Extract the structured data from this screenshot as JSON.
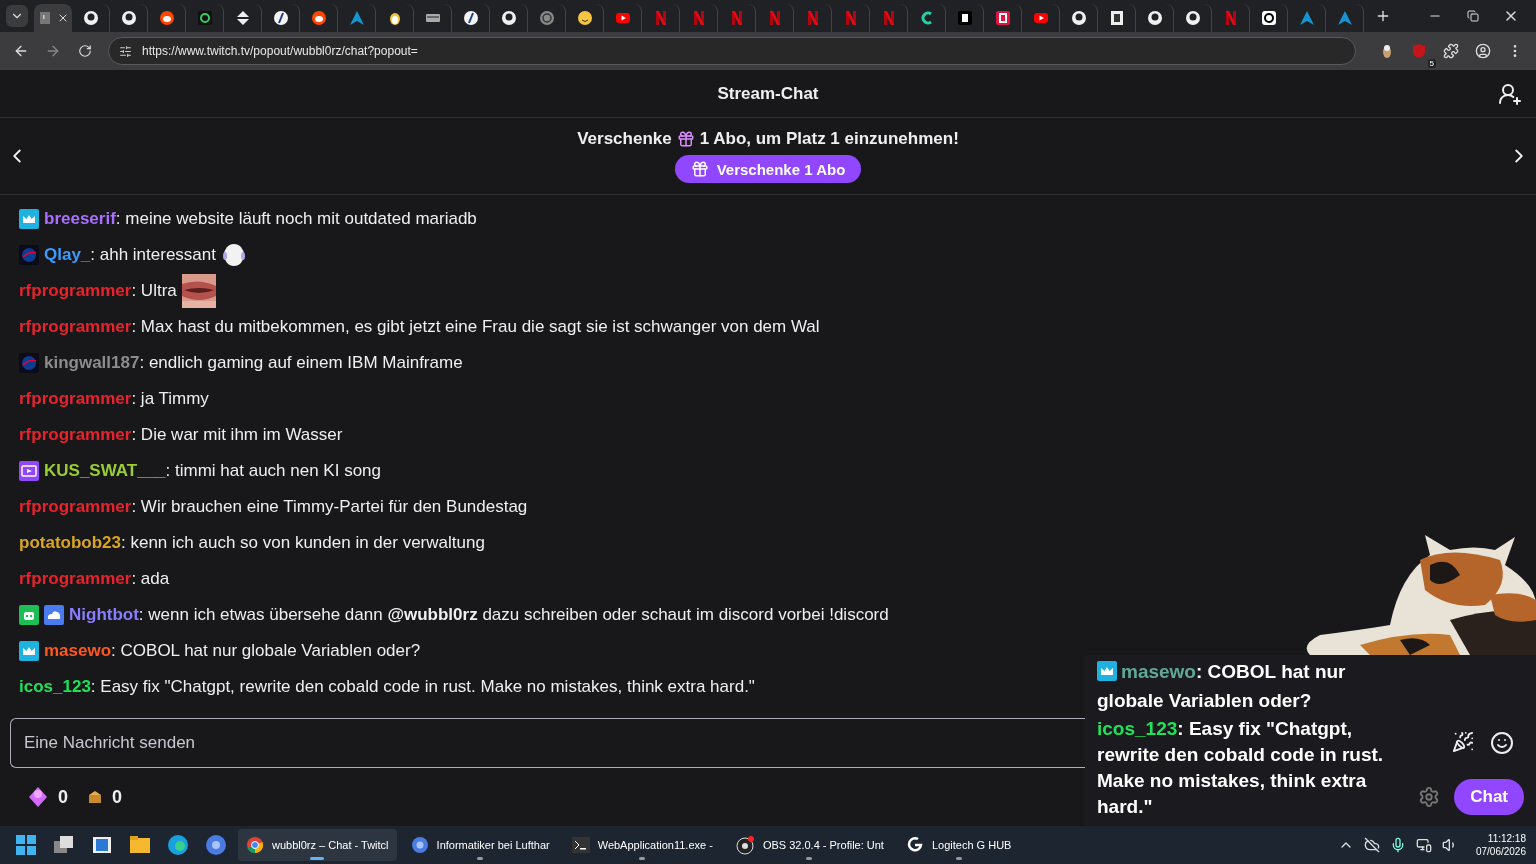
{
  "browser": {
    "tabs": [
      {
        "kind": "twitch",
        "selected": true
      },
      {
        "kind": "github",
        "selected": false
      },
      {
        "kind": "github",
        "selected": false
      },
      {
        "kind": "reddit",
        "selected": false
      },
      {
        "kind": "green-square",
        "selected": false
      },
      {
        "kind": "arrows",
        "selected": false
      },
      {
        "kind": "slash",
        "selected": false
      },
      {
        "kind": "reddit",
        "selected": false
      },
      {
        "kind": "arch",
        "selected": false
      },
      {
        "kind": "penguin",
        "selected": false
      },
      {
        "kind": "card",
        "selected": false
      },
      {
        "kind": "slash",
        "selected": false
      },
      {
        "kind": "github",
        "selected": false
      },
      {
        "kind": "globe",
        "selected": false
      },
      {
        "kind": "smiley",
        "selected": false
      },
      {
        "kind": "youtube",
        "selected": false
      },
      {
        "kind": "netflix",
        "selected": false
      },
      {
        "kind": "netflix",
        "selected": false
      },
      {
        "kind": "netflix",
        "selected": false
      },
      {
        "kind": "netflix",
        "selected": false
      },
      {
        "kind": "netflix",
        "selected": false
      },
      {
        "kind": "netflix",
        "selected": false
      },
      {
        "kind": "netflix",
        "selected": false
      },
      {
        "kind": "cyan-c",
        "selected": false
      },
      {
        "kind": "black-square",
        "selected": false
      },
      {
        "kind": "red-square",
        "selected": false
      },
      {
        "kind": "youtube",
        "selected": false
      },
      {
        "kind": "github",
        "selected": false
      },
      {
        "kind": "document",
        "selected": false
      },
      {
        "kind": "github",
        "selected": false
      },
      {
        "kind": "github",
        "selected": false
      },
      {
        "kind": "netflix",
        "selected": false
      },
      {
        "kind": "threads",
        "selected": false
      },
      {
        "kind": "arch",
        "selected": false
      },
      {
        "kind": "arch",
        "selected": false
      }
    ],
    "url": "https://www.twitch.tv/popout/wubbl0rz/chat?popout=",
    "extension_count": "5"
  },
  "chat": {
    "title": "Stream-Chat",
    "banner": {
      "text_before": "Verschenke",
      "text_after": "1 Abo, um Platz 1 einzunehmen!",
      "button": "Verschenke 1 Abo"
    },
    "messages": [
      {
        "badges": [
          {
            "kind": "crown"
          }
        ],
        "user": "breeserif",
        "color": "#a970ff",
        "text": ": meine website läuft noch mit outdated mariadb"
      },
      {
        "badges": [
          {
            "kind": "space"
          }
        ],
        "user": "Qlay_",
        "color": "#3d9bff",
        "text": ": ahh interessant",
        "emote": {
          "kind": "ghost"
        }
      },
      {
        "user": "rfprogrammer",
        "color": "#e8232d",
        "text": ": Ultra"
      },
      {
        "user": "rfprogrammer",
        "color": "#e8232d",
        "text": ": Max hast du mitbekommen, es gibt jetzt eine Frau die sagt sie ist schwanger von dem Wal"
      },
      {
        "badges": [
          {
            "kind": "space"
          }
        ],
        "user": "kingwall187",
        "color": "#8c8c8c",
        "text": ": endlich gaming auf einem IBM Mainframe"
      },
      {
        "user": "rfprogrammer",
        "color": "#e8232d",
        "text": ": ja Timmy"
      },
      {
        "user": "rfprogrammer",
        "color": "#e8232d",
        "text": ": Die war mit ihm im Wasser"
      },
      {
        "badges": [
          {
            "kind": "video"
          }
        ],
        "user": "KUS_SWAT___",
        "color": "#9acd32",
        "text": ": timmi hat auch nen KI song"
      },
      {
        "user": "rfprogrammer",
        "color": "#e8232d",
        "text": ": Wir brauchen eine Timmy-Partei für den Bundestag"
      },
      {
        "user": "potatobob23",
        "color": "#daa520",
        "text": ": kenn ich auch so von kunden in der verwaltung"
      },
      {
        "user": "rfprogrammer",
        "color": "#e8232d",
        "text": ": ada"
      },
      {
        "badges": [
          {
            "kind": "robot"
          },
          {
            "kind": "cloud"
          }
        ],
        "user": "Nightbot",
        "color": "#8a7cff",
        "text": ": wenn ich etwas übersehe dann **@wubbl0rz** dazu schreiben oder schaut im discord vorbei !discord"
      },
      {
        "badges": [
          {
            "kind": "crown"
          }
        ],
        "user": "masewo",
        "color": "#ff5722",
        "text": ": COBOL hat nur globale Variablen oder?"
      },
      {
        "user": "icos_123",
        "color": "#1ee35a",
        "text": ": Easy fix \"Chatgpt, rewrite den cobald code in rust. Make no mistakes, think extra hard.\""
      }
    ],
    "input": {
      "placeholder": "Eine Nachricht senden"
    },
    "points": [
      {
        "kind": "gem",
        "value": "0"
      },
      {
        "kind": "coin",
        "value": "0"
      }
    ],
    "chat_button": "Chat"
  },
  "overlay": {
    "messages": [
      {
        "badges": [
          {
            "kind": "crown"
          }
        ],
        "user": "masewo",
        "color": "#5fa89a",
        "text": ": COBOL hat nur globale Variablen oder?"
      },
      {
        "user": "icos_123",
        "color": "#1ee35a",
        "text": ": Easy fix \"Chatgpt, rewrite den cobald code in rust. Make no mistakes, think extra hard.\""
      }
    ]
  },
  "taskbar": {
    "pinned": [
      {
        "kind": "start"
      },
      {
        "kind": "taskview"
      },
      {
        "kind": "media"
      },
      {
        "kind": "explorer"
      },
      {
        "kind": "edge"
      },
      {
        "kind": "chrome-blue"
      }
    ],
    "apps": [
      {
        "kind": "chrome",
        "label": "wubbl0rz – Chat - Twitcl",
        "selected": true
      },
      {
        "kind": "chrome-blue",
        "label": "Informatiker bei Lufthar",
        "selected": false
      },
      {
        "kind": "terminal",
        "label": "WebApplication11.exe -",
        "selected": false
      },
      {
        "kind": "obs",
        "label": "OBS 32.0.4 - Profile: Unt",
        "selected": false
      },
      {
        "kind": "logitech",
        "label": "Logitech G HUB",
        "selected": false
      }
    ],
    "clock": {
      "time": "11:12:18",
      "date": "07/06/2026"
    }
  }
}
